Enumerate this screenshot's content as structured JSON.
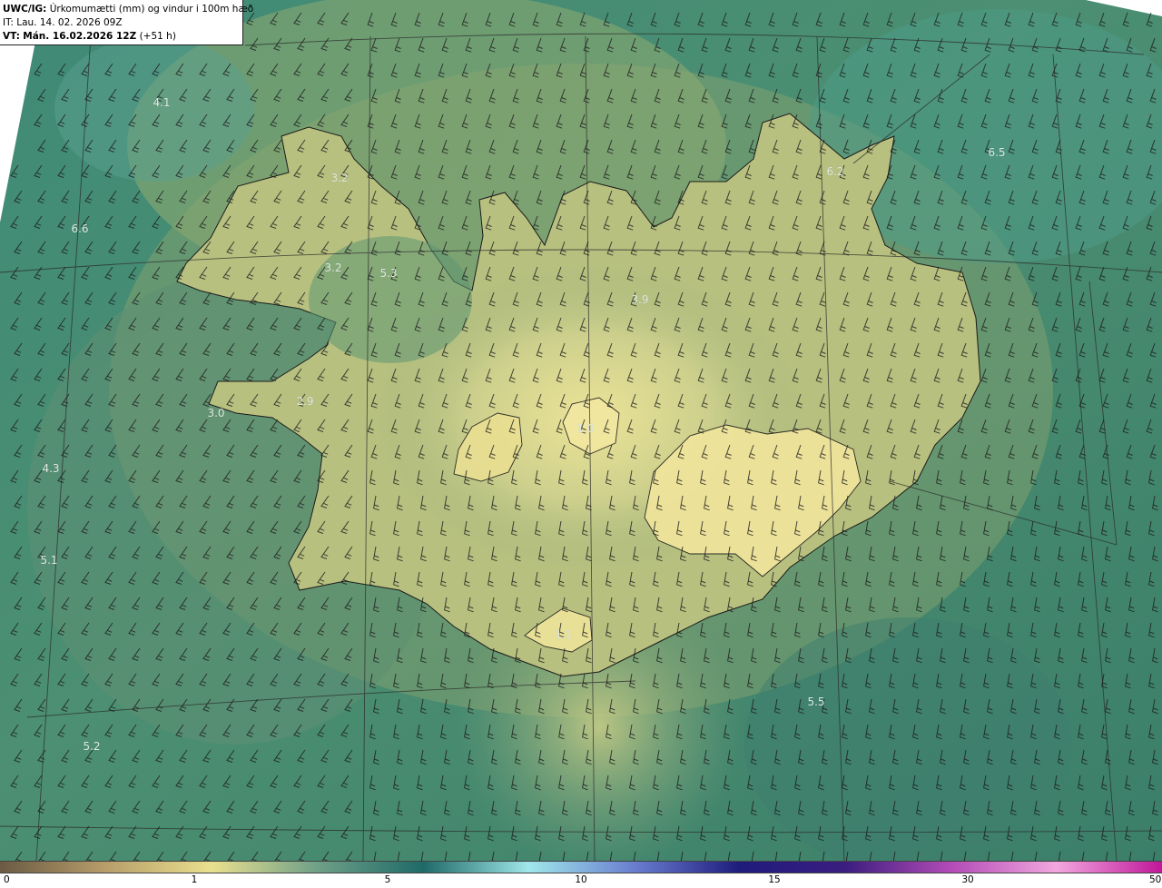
{
  "header": {
    "product": "UWC/IG:",
    "description": "Úrkomumætti (mm) og vindur i 100m hæð",
    "issue_time": "IT: Lau. 14. 02. 2026 09Z",
    "valid_label": "VT:",
    "valid_time": "Mán. 16.02.2026 12Z",
    "lead_time": "(+51 h)"
  },
  "map_values": [
    "4.1",
    "3.2",
    "3.2",
    "5.3",
    "6.6",
    "6.2",
    "6.5",
    "3.9",
    "2.9",
    "3.0",
    "1.0",
    "4.3",
    "5.1",
    "1.1",
    "5.5",
    "5.2"
  ],
  "colorbar": {
    "ticks": [
      "0",
      "1",
      "5",
      "10",
      "15",
      "30",
      "50"
    ],
    "colors": [
      "#6b5a44",
      "#b79e6a",
      "#e9e08e",
      "#6fa088",
      "#1f6a68",
      "#9fe7ea",
      "#6a7fd0",
      "#1f1c7c",
      "#3a1d7f",
      "#b34bb6",
      "#f2a7df",
      "#c0179a"
    ]
  }
}
